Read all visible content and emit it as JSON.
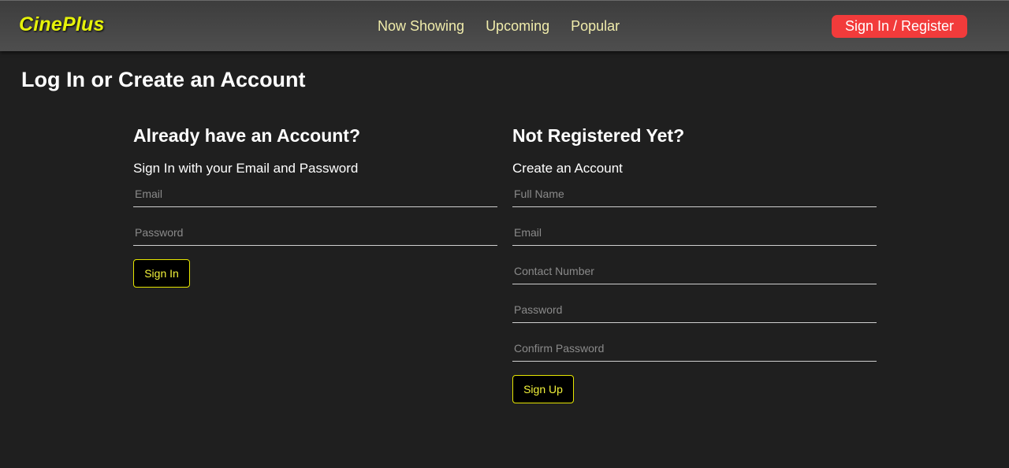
{
  "header": {
    "logo": "CinePlus",
    "nav": [
      "Now Showing",
      "Upcoming",
      "Popular"
    ],
    "auth_button": "Sign In / Register"
  },
  "page": {
    "title": "Log In or Create an Account"
  },
  "login": {
    "heading": "Already have an Account?",
    "subheading": "Sign In with your Email and Password",
    "email_placeholder": "Email",
    "password_placeholder": "Password",
    "button": "Sign In"
  },
  "register": {
    "heading": "Not Registered Yet?",
    "subheading": "Create an Account",
    "fullname_placeholder": "Full Name",
    "email_placeholder": "Email",
    "contact_placeholder": "Contact Number",
    "password_placeholder": "Password",
    "confirm_placeholder": "Confirm Password",
    "button": "Sign Up"
  },
  "colors": {
    "background": "#1f1f1f",
    "header": "#484848",
    "logo": "#e6f20a",
    "nav_text": "#f0ecab",
    "auth_button": "#f23b3b",
    "button_border": "#e6e600"
  }
}
